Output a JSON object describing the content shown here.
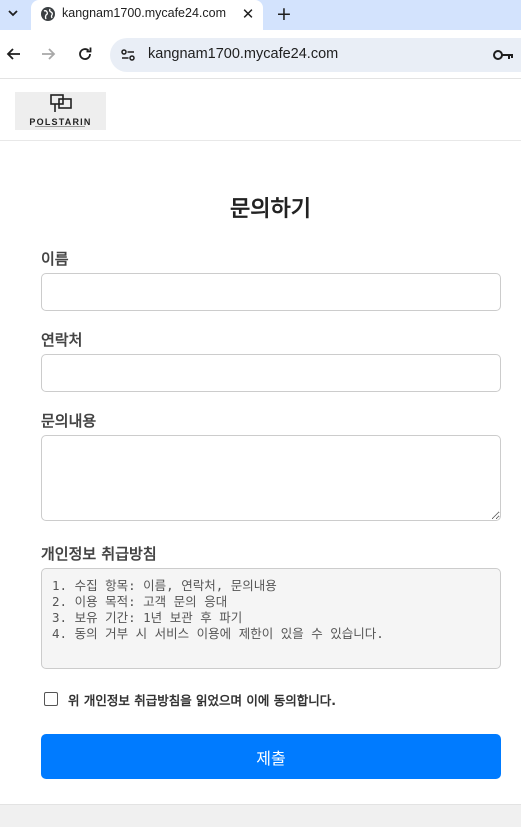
{
  "browser": {
    "tab": {
      "title": "kangnam1700.mycafe24.com",
      "favicon": "globe-icon"
    },
    "url": "kangnam1700.mycafe24.com",
    "icons": {
      "tab_list": "chevron-down-icon",
      "close": "close-icon",
      "new_tab": "plus-icon",
      "back": "arrow-left-icon",
      "forward": "arrow-right-icon",
      "reload": "reload-icon",
      "site_info": "site-settings-icon",
      "password": "key-icon"
    },
    "tab_close_glyph": "✕",
    "new_tab_glyph": "+",
    "tabbar_color": "#d3e3fd",
    "omnibox_color": "#e9eef6"
  },
  "site": {
    "logo_text": "POLSTARIN"
  },
  "form": {
    "title": "문의하기",
    "name_label": "이름",
    "name_value": "",
    "contact_label": "연락처",
    "contact_value": "",
    "message_label": "문의내용",
    "message_value": "",
    "policy_label": "개인정보 취급방침",
    "policy_lines": [
      "1. 수집 항목: 이름, 연락처, 문의내용",
      "2. 이용 목적: 고객 문의 응대",
      "3. 보유 기간: 1년 보관 후 파기",
      "4. 동의 거부 시 서비스 이용에 제한이 있을 수 있습니다."
    ],
    "agree_label": "위 개인정보 취급방침을 읽었으며 이에 동의합니다.",
    "agree_checked": false,
    "submit_label": "제출",
    "accent_color": "#007bff"
  }
}
